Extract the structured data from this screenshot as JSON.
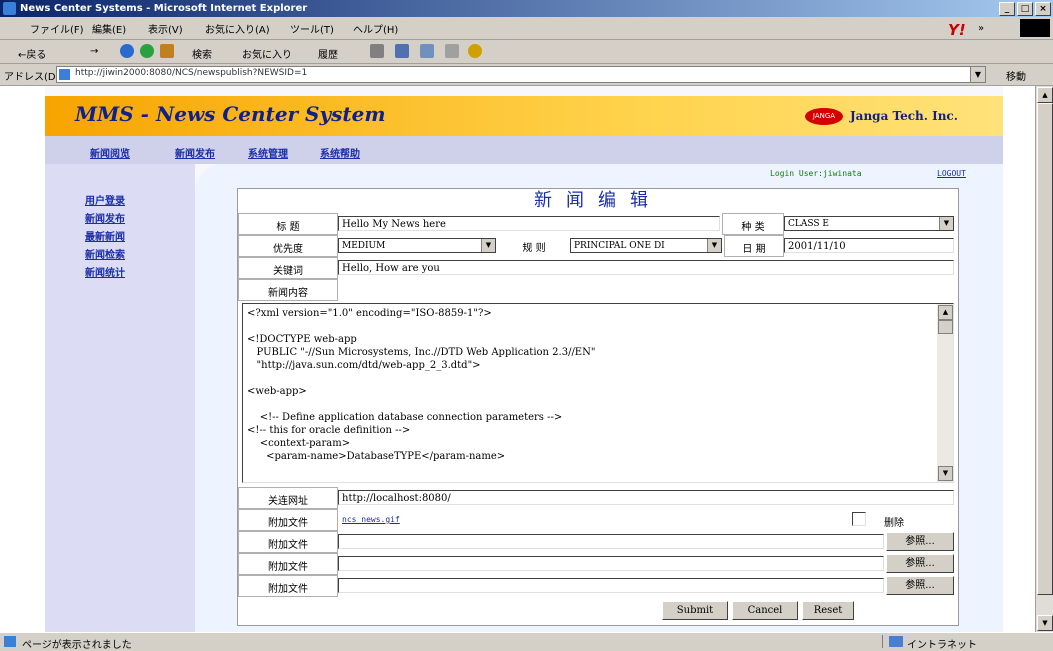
{
  "window": {
    "title": "News Center Systems - Microsoft Internet Explorer",
    "min": "_",
    "max": "□",
    "close": "×"
  },
  "menubar": {
    "items": [
      "ファイル(F)",
      "編集(E)",
      "表示(V)",
      "お気に入り(A)",
      "ツール(T)",
      "ヘルプ(H)"
    ],
    "yahoo": "Y!",
    "chevron": "»"
  },
  "toolbar": {
    "back": "←戻る",
    "forward": "→",
    "search": "検索",
    "favorites": "お気に入り",
    "history": "履歴"
  },
  "address": {
    "label": "アドレス(D)",
    "url": "http://jiwin2000:8080/NCS/newspublish?NEWSID=1",
    "go": "移動"
  },
  "header": {
    "title": "MMS - News Center System",
    "logo": "JANGA",
    "company": "Janga Tech. Inc."
  },
  "nav": {
    "items": [
      "新闻阅览",
      "新闻发布",
      "系统管理",
      "系统帮助"
    ]
  },
  "sidebar": {
    "items": [
      "用户登录",
      "新闻发布",
      "最新新闻",
      "新闻检索",
      "新闻统计"
    ]
  },
  "login": {
    "text": "Login User:jiwinata",
    "logout": "LOGOUT"
  },
  "form": {
    "title": "新闻编辑",
    "title_label": "标 题",
    "title_value": "Hello My News here",
    "category_label": "种 类",
    "category_value": "CLASS E",
    "priority_label": "优先度",
    "priority_value": "MEDIUM",
    "rule_label": "规 则",
    "rule_value": "PRINCIPAL ONE DI",
    "date_label": "日 期",
    "date_value": "2001/11/10",
    "keyword_label": "关键词",
    "keyword_value": "Hello, How are you",
    "content_label": "新闻内容",
    "content_value": "<?xml version=\"1.0\" encoding=\"ISO-8859-1\"?>\n\n<!DOCTYPE web-app\n   PUBLIC \"-//Sun Microsystems, Inc.//DTD Web Application 2.3//EN\"\n   \"http://java.sun.com/dtd/web-app_2_3.dtd\">\n\n<web-app>\n\n    <!-- Define application database connection parameters -->\n<!-- this for oracle definition -->\n    <context-param>\n      <param-name>DatabaseTYPE</param-name>",
    "url_label": "关连网址",
    "url_value": "http://localhost:8080/",
    "attachments": [
      {
        "label": "附加文件",
        "file": "ncs_news.gif",
        "delete_label": "删除"
      },
      {
        "label": "附加文件",
        "browse": "参照..."
      },
      {
        "label": "附加文件",
        "browse": "参照..."
      },
      {
        "label": "附加文件",
        "browse": "参照..."
      }
    ],
    "submit": "Submit",
    "cancel": "Cancel",
    "reset": "Reset"
  },
  "status": {
    "text": "ページが表示されました",
    "zone": "イントラネット"
  }
}
